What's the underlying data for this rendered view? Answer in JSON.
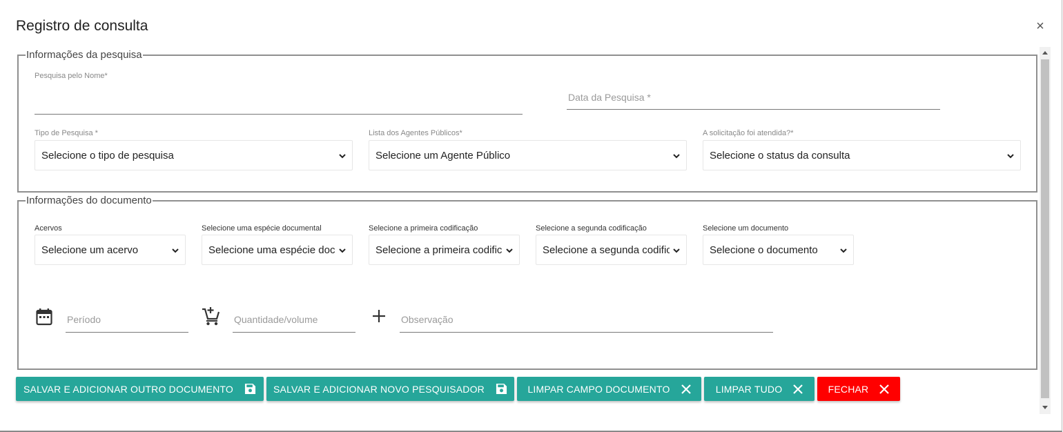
{
  "dialog": {
    "title": "Registro de consulta",
    "close_glyph": "×"
  },
  "pesquisa": {
    "legend": "Informações da pesquisa",
    "nome_label": "Pesquisa pelo Nome*",
    "nome_value": "",
    "data_placeholder": "Data da Pesquisa *",
    "tipo_label": "Tipo de Pesquisa *",
    "tipo_selected": "Selecione o tipo de pesquisa",
    "agentes_label": "Lista dos Agentes Públicos*",
    "agentes_selected": "Selecione um Agente Público",
    "atendida_label": "A solicitação foi atendida?*",
    "atendida_selected": "Selecione o status da consulta"
  },
  "documento": {
    "legend": "Informações do documento",
    "acervos_label": "Acervos",
    "acervos_selected": "Selecione um acervo",
    "especie_label": "Selecione uma espécie documental",
    "especie_selected": "Selecione uma espécie docu",
    "primeira_label": "Selecione a primeira codificação",
    "primeira_selected": "Selecione a primeira codifica",
    "segunda_label": "Selecione a segunda codificação",
    "segunda_selected": "Selecione a segunda codifica",
    "documento_label": "Selecione um documento",
    "documento_selected": "Selecione o documento",
    "periodo_placeholder": "Período",
    "quantidade_placeholder": "Quantidade/volume",
    "observacao_placeholder": "Observação",
    "icons": [
      "calendar-icon",
      "add-shopping-cart-icon",
      "plus-icon"
    ]
  },
  "buttons": {
    "salvar_outro": "SALVAR E ADICIONAR OUTRO DOCUMENTO",
    "salvar_novo": "SALVAR E ADICIONAR NOVO PESQUISADOR",
    "limpar_documento": "LIMPAR CAMPO DOCUMENTO",
    "limpar_tudo": "LIMPAR TUDO",
    "fechar": "FECHAR"
  },
  "colors": {
    "primary": "#26a69a",
    "danger": "#ff0000",
    "border": "#8f8f8f"
  }
}
